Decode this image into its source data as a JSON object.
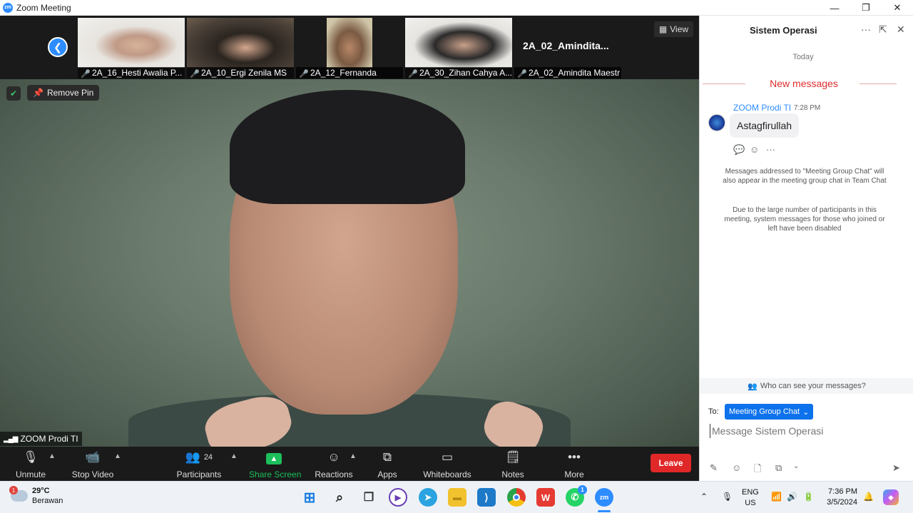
{
  "window": {
    "title": "Zoom Meeting",
    "app_icon_text": "zm"
  },
  "window_controls": {
    "minimize": "—",
    "maximize": "❐",
    "close": "✕"
  },
  "thumbnails": [
    {
      "name": "2A_16_Hesti Awalia P...",
      "muted": true
    },
    {
      "name": "2A_10_Ergi Zenila MS",
      "muted": true
    },
    {
      "name": "2A_12_Fernanda",
      "muted": true
    },
    {
      "name": "2A_30_Zihan Cahya A...",
      "muted": true
    },
    {
      "name": "2A_02_Amindita Maestr",
      "muted": true,
      "big_label": "2A_02_Amindita..."
    }
  ],
  "view_button": "View",
  "remove_pin": "Remove Pin",
  "speaker_name": "ZOOM Prodi TI",
  "toolbar": {
    "unmute": "Unmute",
    "stop_video": "Stop Video",
    "participants": "Participants",
    "participants_count": "24",
    "share_screen": "Share Screen",
    "reactions": "Reactions",
    "apps": "Apps",
    "whiteboards": "Whiteboards",
    "notes": "Notes",
    "more": "More",
    "leave": "Leave"
  },
  "chat": {
    "title": "Sistem Operasi",
    "today": "Today",
    "new_messages": "New messages",
    "message": {
      "sender": "ZOOM Prodi TI",
      "time": "7:28 PM",
      "text": "Astagfirullah"
    },
    "system_message_1": "Messages addressed to \"Meeting Group Chat\" will also appear in the meeting group chat in Team Chat",
    "system_message_2": "Due to the large number of participants in this meeting, system messages for those who joined or left have been disabled",
    "who_can_see": "Who can see your messages?",
    "to_label": "To:",
    "to_value": "Meeting Group Chat",
    "input_placeholder": "Message Sistem Operasi"
  },
  "taskbar": {
    "weather_temp": "29°C",
    "weather_desc": "Berawan",
    "weather_badge": "1",
    "lang_line1": "ENG",
    "lang_line2": "US",
    "time": "7:36 PM",
    "date": "3/5/2024",
    "whatsapp_badge": "1",
    "zoom_icon_text": "zm"
  },
  "colors": {
    "accent": "#2d8cff",
    "leave": "#e02828",
    "new_messages": "#e02d2d",
    "share_screen": "#1cbf5b"
  }
}
